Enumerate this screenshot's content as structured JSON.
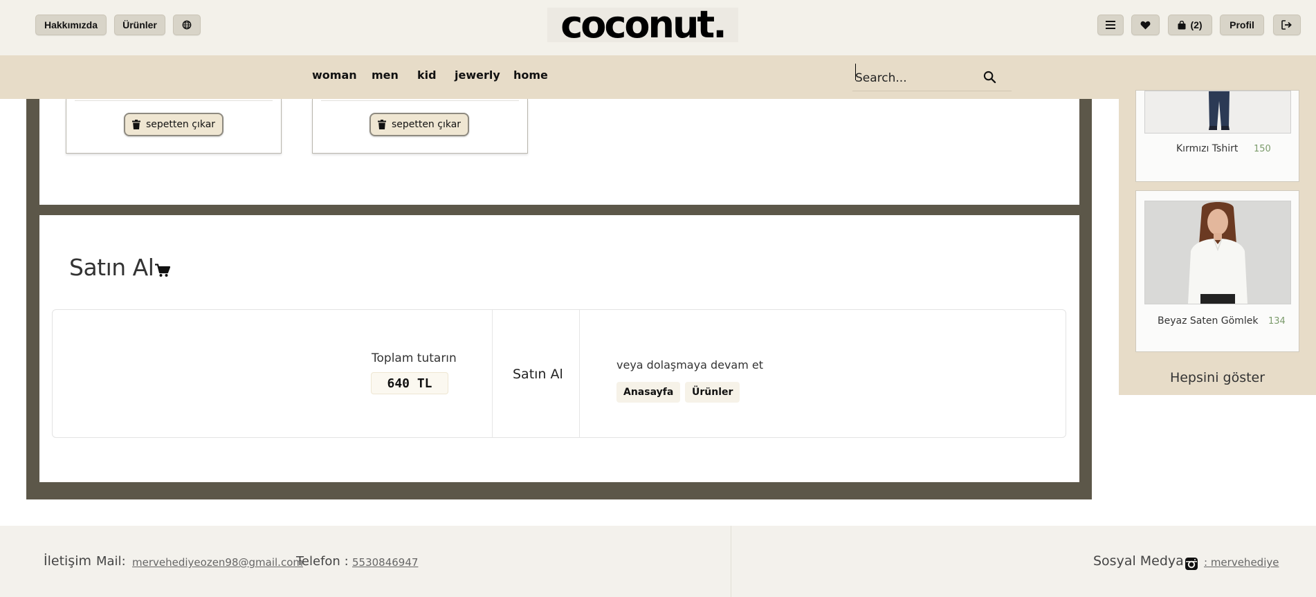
{
  "header": {
    "about_label": "Hakkımızda",
    "products_label": "Ürünler",
    "logo_text": "coconut.",
    "cart_count": "(2)",
    "profile_label": "Profil"
  },
  "nav": {
    "items": [
      "woman",
      "men",
      "kid",
      "jewerly",
      "home"
    ],
    "search_placeholder": "Search..."
  },
  "cart": {
    "remove_label": "sepetten çıkar"
  },
  "checkout": {
    "title": "Satın Al",
    "total_label": "Toplam tutarın",
    "total_value": "640 TL",
    "buy_label": "Satın Al",
    "continue_text": "veya dolaşmaya devam et",
    "home_btn": "Anasayfa",
    "products_btn": "Ürünler"
  },
  "sidebar": {
    "products": [
      {
        "name": "Kırmızı Tshirt",
        "price": "150"
      },
      {
        "name": "Beyaz Saten Gömlek",
        "price": "134"
      }
    ],
    "show_all": "Hepsini göster"
  },
  "footer": {
    "contact_label": "İletişim",
    "mail_label": "Mail:",
    "mail_value": "mervehediyeozen98@gmail.com",
    "phone_label": "Telefon :",
    "phone_value": "5530846947",
    "social_label": "Sosyal Medya",
    "social_handle": ": mervehediye"
  },
  "colors": {
    "page_bg": "#f3f1ea",
    "nav_bg": "#e7dcc8",
    "frame": "#5c5749",
    "button_bg": "#d8d4c8"
  }
}
